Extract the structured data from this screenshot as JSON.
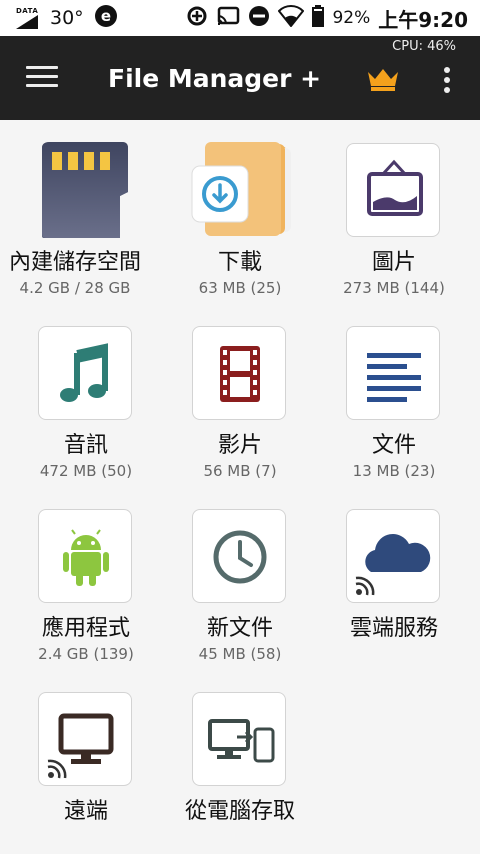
{
  "status_bar": {
    "data_label": "DATA",
    "temperature": "30°",
    "battery": "92%",
    "time": "上午9:20"
  },
  "app_bar": {
    "title": "File Manager +",
    "cpu": "CPU: 46%"
  },
  "tiles": [
    {
      "label": "內建儲存空間",
      "sub": "4.2 GB / 28 GB",
      "icon": "sd-card-icon"
    },
    {
      "label": "下載",
      "sub": "63 MB (25)",
      "icon": "download-folder-icon"
    },
    {
      "label": "圖片",
      "sub": "273 MB (144)",
      "icon": "picture-icon"
    },
    {
      "label": "音訊",
      "sub": "472 MB (50)",
      "icon": "music-note-icon"
    },
    {
      "label": "影片",
      "sub": "56 MB (7)",
      "icon": "film-icon"
    },
    {
      "label": "文件",
      "sub": "13 MB (23)",
      "icon": "document-lines-icon"
    },
    {
      "label": "應用程式",
      "sub": "2.4 GB (139)",
      "icon": "android-icon"
    },
    {
      "label": "新文件",
      "sub": "45 MB (58)",
      "icon": "clock-icon"
    },
    {
      "label": "雲端服務",
      "sub": "",
      "icon": "cloud-icon"
    },
    {
      "label": "遠端",
      "sub": "",
      "icon": "monitor-icon"
    },
    {
      "label": "從電腦存取",
      "sub": "",
      "icon": "pc-to-phone-icon"
    }
  ],
  "colors": {
    "app_bar": "#222222",
    "crown": "#f4a11c",
    "teal": "#2e7d75",
    "film": "#8b1e1e",
    "docs": "#2b4f8f",
    "android": "#8dc63f",
    "clock": "#556b6b",
    "cloud": "#2f4a7c",
    "picture": "#4b3a6b"
  }
}
